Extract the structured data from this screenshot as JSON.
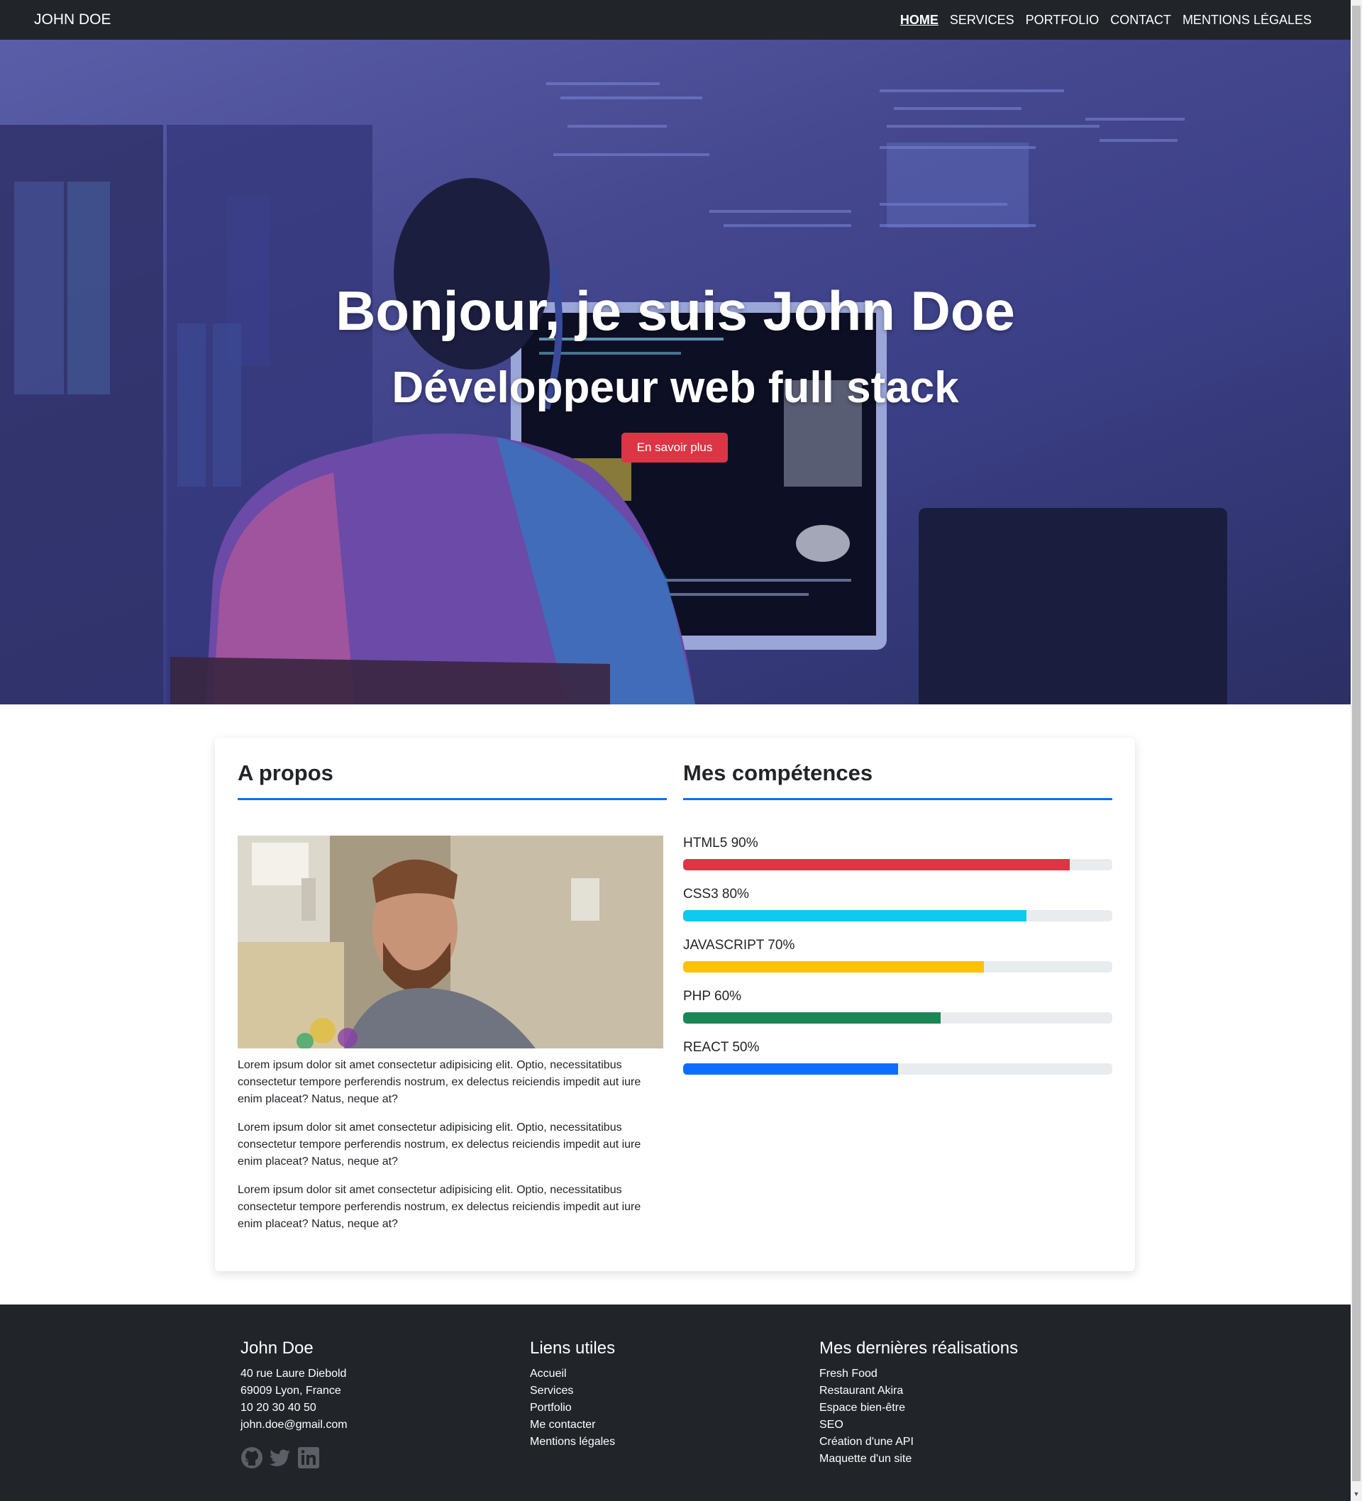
{
  "nav": {
    "brand": "JOHN DOE",
    "links": [
      {
        "label": "HOME",
        "active": true
      },
      {
        "label": "SERVICES"
      },
      {
        "label": "PORTFOLIO"
      },
      {
        "label": "CONTACT"
      },
      {
        "label": "MENTIONS LÉGALES"
      }
    ]
  },
  "hero": {
    "title": "Bonjour, je suis John Doe",
    "subtitle": "Développeur web full stack",
    "button_label": "En savoir plus"
  },
  "about": {
    "title": "A propos",
    "paragraphs": [
      "Lorem ipsum dolor sit amet consectetur adipisicing elit. Optio, necessitatibus consectetur tempore perferendis nostrum, ex delectus reiciendis impedit aut iure enim placeat? Natus, neque at?",
      "Lorem ipsum dolor sit amet consectetur adipisicing elit. Optio, necessitatibus consectetur tempore perferendis nostrum, ex delectus reiciendis impedit aut iure enim placeat? Natus, neque at?",
      "Lorem ipsum dolor sit amet consectetur adipisicing elit. Optio, necessitatibus consectetur tempore perferendis nostrum, ex delectus reiciendis impedit aut iure enim placeat? Natus, neque at?"
    ]
  },
  "skills": {
    "title": "Mes compétences",
    "items": [
      {
        "label": "HTML5 90%",
        "percent": 90,
        "color": "#dc3545"
      },
      {
        "label": "CSS3 80%",
        "percent": 80,
        "color": "#0dcaf0"
      },
      {
        "label": "JAVASCRIPT 70%",
        "percent": 70,
        "color": "#ffc107"
      },
      {
        "label": "PHP 60%",
        "percent": 60,
        "color": "#198754"
      },
      {
        "label": "REACT 50%",
        "percent": 50,
        "color": "#0d6efd"
      }
    ]
  },
  "footer": {
    "contact": {
      "title": "John Doe",
      "address1": "40 rue Laure Diebold",
      "address2": "69009 Lyon, France",
      "phone": "10 20 30 40 50",
      "email": "john.doe@gmail.com"
    },
    "links": {
      "title": "Liens utiles",
      "items": [
        "Accueil",
        "Services",
        "Portfolio",
        "Me contacter",
        "Mentions légales"
      ]
    },
    "works": {
      "title": "Mes dernières réalisations",
      "items": [
        "Fresh Food",
        "Restaurant Akira",
        "Espace bien-être",
        "SEO",
        "Création d'une API",
        "Maquette d'un site"
      ]
    },
    "socials": [
      "github-icon",
      "twitter-icon",
      "linkedin-icon"
    ]
  },
  "colors": {
    "navbar": "#212529",
    "accent": "#0d6efd",
    "button": "#dc3545"
  }
}
